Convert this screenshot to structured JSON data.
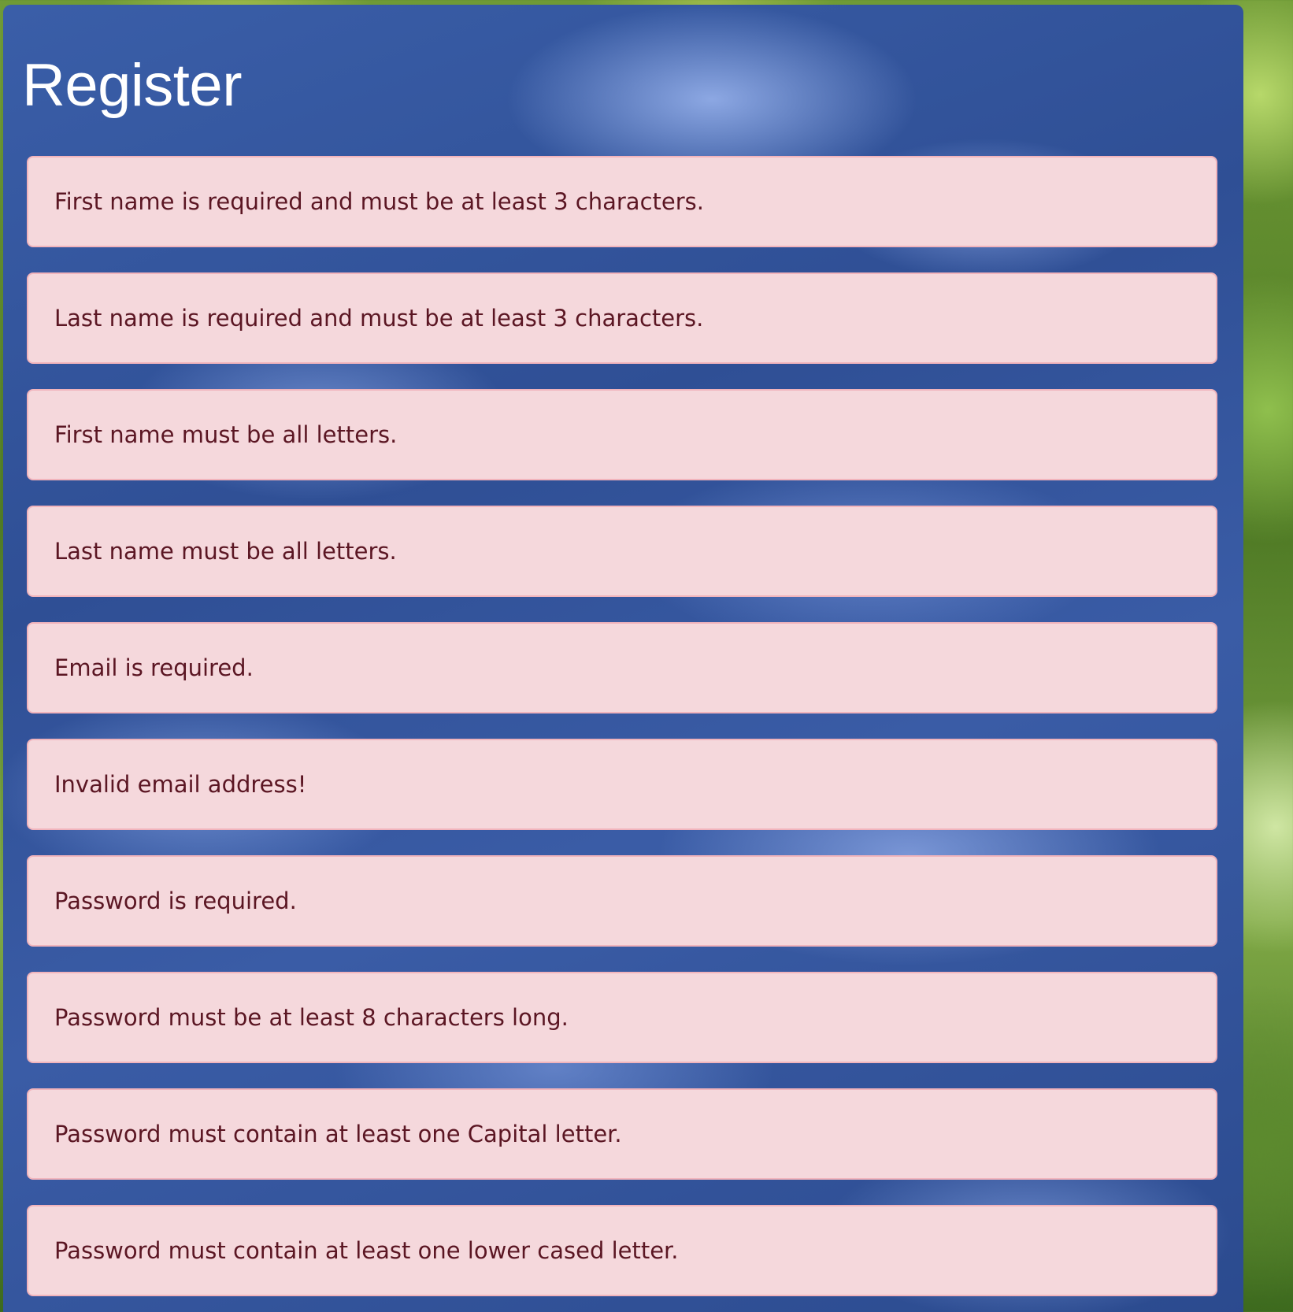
{
  "form": {
    "title": "Register"
  },
  "alerts": [
    "First name is required and must be at least 3 characters.",
    "Last name is required and must be at least 3 characters.",
    "First name must be all letters.",
    "Last name must be all letters.",
    "Email is required.",
    "Invalid email address!",
    "Password is required.",
    "Password must be at least 8 characters long.",
    "Password must contain at least one Capital letter.",
    "Password must contain at least one lower cased letter."
  ],
  "colors": {
    "panel": "#2f4f95",
    "alert_background": "#f5d8dc",
    "alert_border": "#f1b4bc",
    "alert_text": "#5b1623",
    "title_text": "#ffffff"
  }
}
